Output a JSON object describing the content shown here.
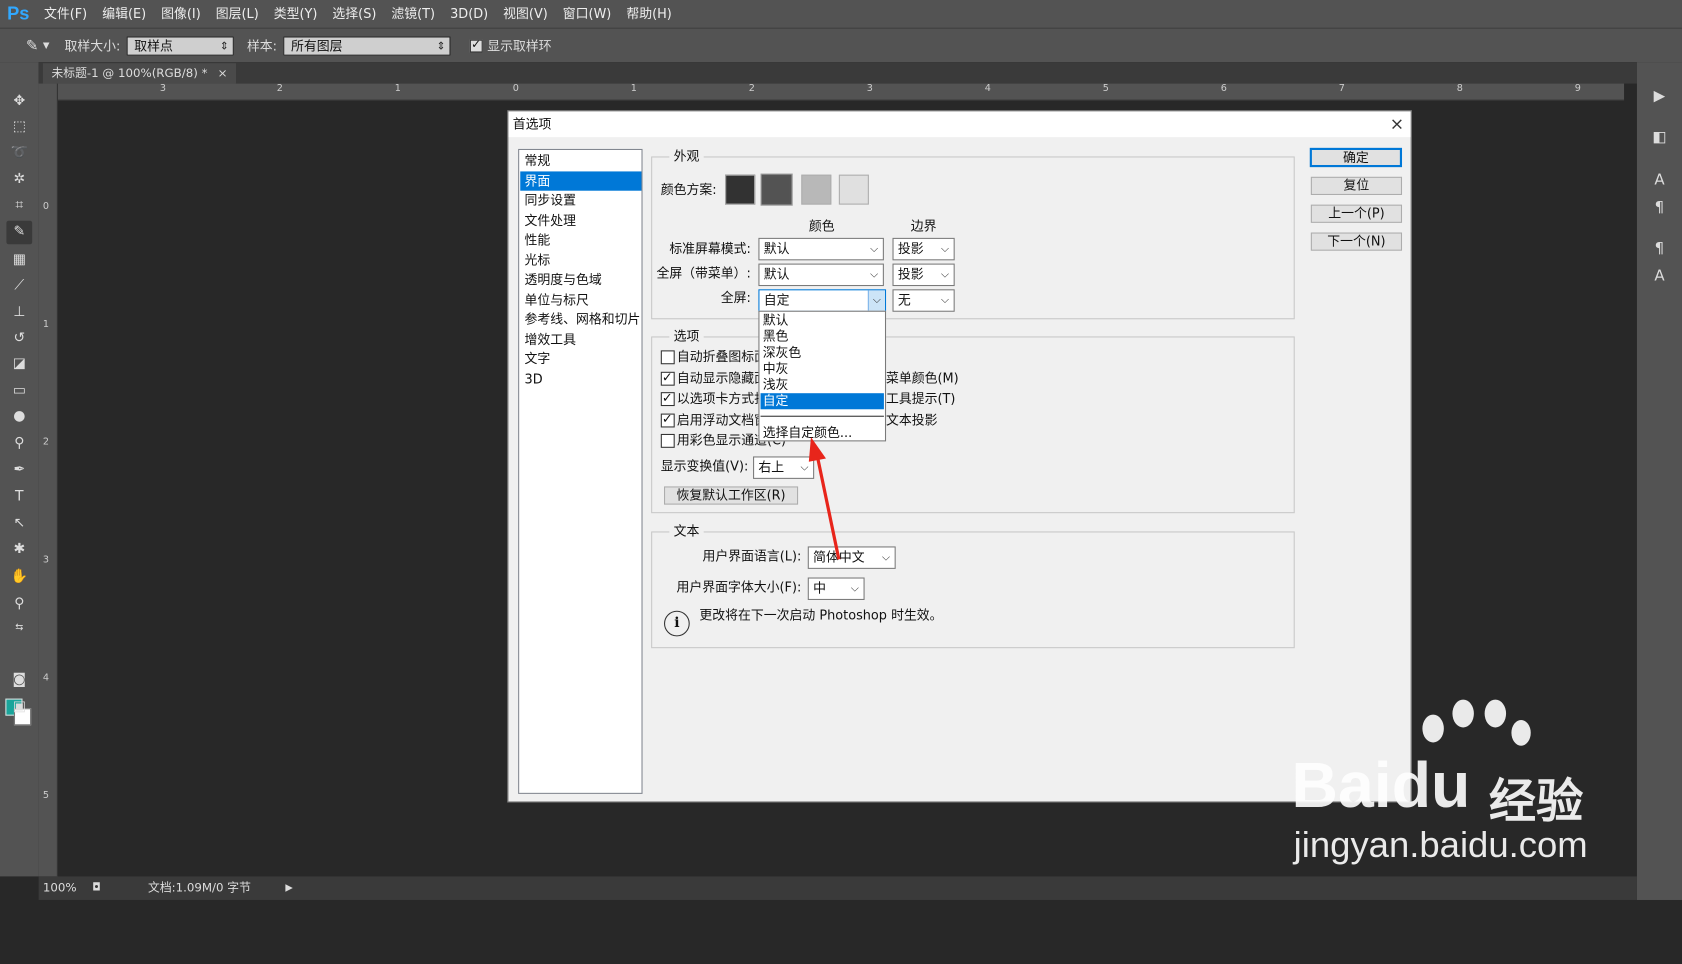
{
  "app": {
    "logo": "Ps"
  },
  "menu": [
    "文件(F)",
    "编辑(E)",
    "图像(I)",
    "图层(L)",
    "类型(Y)",
    "选择(S)",
    "滤镜(T)",
    "3D(D)",
    "视图(V)",
    "窗口(W)",
    "帮助(H)"
  ],
  "options": {
    "sample_size_label": "取样大小:",
    "sample_size_value": "取样点",
    "sample_label": "样本:",
    "sample_value": "所有图层",
    "show_ring_label": "显示取样环"
  },
  "doc_tab": {
    "title": "未标题-1 @ 100%(RGB/8) *",
    "close": "×"
  },
  "ruler_h": [
    "3",
    "2",
    "1",
    "0",
    "1",
    "2",
    "3",
    "4",
    "5",
    "6",
    "7",
    "8",
    "9"
  ],
  "ruler_v": [
    "0",
    "1",
    "2",
    "3",
    "4",
    "5"
  ],
  "status": {
    "zoom": "100%",
    "doc": "文档:1.09M/0 字节",
    "arrow": "▶"
  },
  "dialog": {
    "title": "首选项",
    "close": "×",
    "categories": [
      "常规",
      "界面",
      "同步设置",
      "文件处理",
      "性能",
      "光标",
      "透明度与色域",
      "单位与标尺",
      "参考线、网格和切片",
      "增效工具",
      "文字",
      "3D"
    ],
    "selected_category": "界面",
    "appearance": {
      "group": "外观",
      "color_scheme_label": "颜色方案:",
      "scheme_colors": [
        "#323232",
        "#535353",
        "#b8b8b8",
        "#e0e0e0"
      ],
      "col_color": "颜色",
      "col_border": "边界",
      "rows": [
        {
          "label": "标准屏幕模式:",
          "color": "默认",
          "border": "投影"
        },
        {
          "label": "全屏（带菜单）:",
          "color": "默认",
          "border": "投影"
        },
        {
          "label": "全屏:",
          "color": "自定",
          "border": "无"
        }
      ]
    },
    "dropdown_options": [
      "默认",
      "黑色",
      "深灰色",
      "中灰",
      "浅灰",
      "自定",
      "选择自定颜色..."
    ],
    "dropdown_selected": "自定",
    "options_group": {
      "group": "选项",
      "items": [
        {
          "label": "自动折叠图标面",
          "checked": false
        },
        {
          "label": "自动显示隐藏面",
          "checked": true
        },
        {
          "label": "以选项卡方式打",
          "checked": true
        },
        {
          "label": "启用浮动文档窗",
          "checked": true
        },
        {
          "label": "用彩色显示通道(C)",
          "checked": false
        }
      ],
      "right_labels": [
        "菜单颜色(M)",
        "工具提示(T)",
        "文本投影"
      ],
      "transform_label": "显示变换值(V):",
      "transform_value": "右上",
      "restore_button": "恢复默认工作区(R)"
    },
    "text_group": {
      "group": "文本",
      "ui_lang_label": "用户界面语言(L):",
      "ui_lang_value": "简体中文",
      "ui_size_label": "用户界面字体大小(F):",
      "ui_size_value": "中",
      "note": "更改将在下一次启动 Photoshop 时生效。"
    },
    "buttons": {
      "ok": "确定",
      "reset": "复位",
      "prev": "上一个(P)",
      "next": "下一个(N)"
    }
  },
  "watermark": {
    "brand": "Bai",
    "brand2": "du",
    "cn": "经验",
    "url": "jingyan.baidu.com"
  },
  "colors": {
    "foreground": "#1aa59b",
    "background": "#ffffff",
    "accent": "#0078d7",
    "arrow": "#e8251b"
  }
}
